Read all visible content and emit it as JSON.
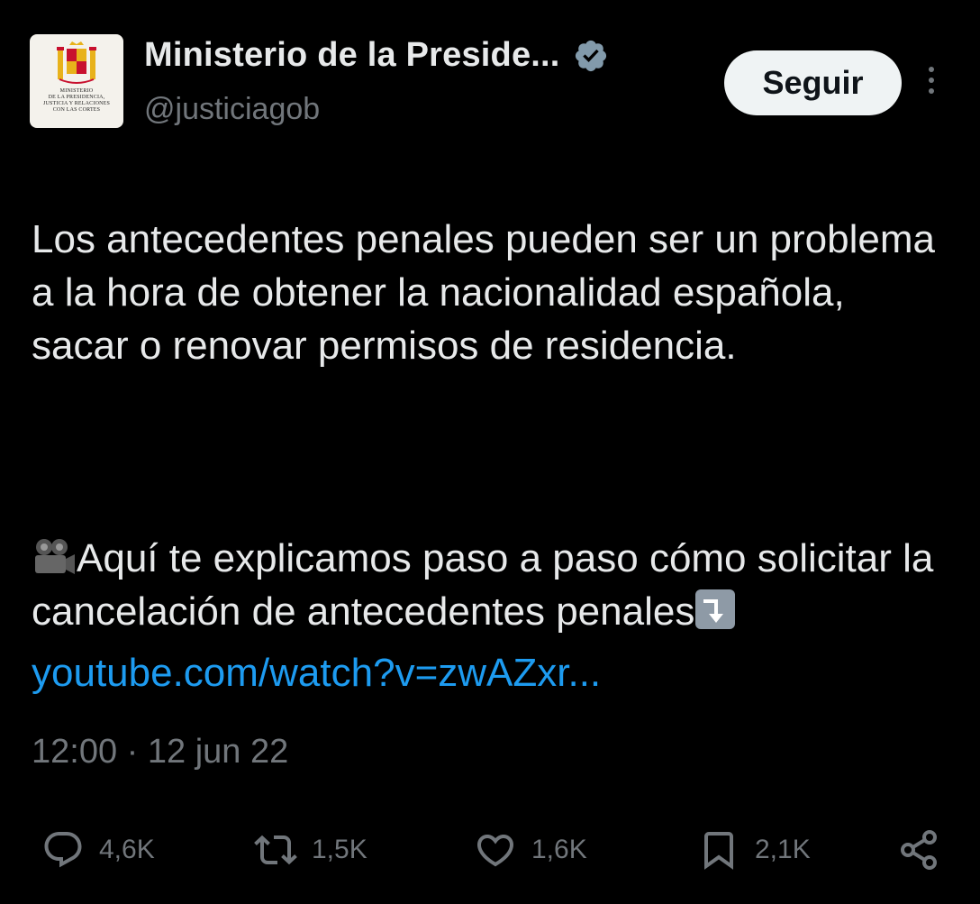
{
  "account": {
    "avatar_text": "MINISTERIO\nDE LA PRESIDENCIA,\nJUSTICIA Y RELACIONES\nCON LAS CORTES",
    "name": "Ministerio de la Preside...",
    "handle": "@justiciagob",
    "verified_icon": "verified-badge-icon"
  },
  "header": {
    "follow_label": "Seguir"
  },
  "tweet": {
    "paragraph1": "Los antecedentes penales pueden ser un problema a la hora de obtener la nacionalidad española, sacar o renovar permisos de residencia.",
    "paragraph2_text": "Aquí te explicamos paso a paso cómo solicitar la cancelación de antecedentes penales",
    "paragraph2_emoji_start": "movie-camera-icon",
    "paragraph2_emoji_end": "arrow-down-icon",
    "link": "youtube.com/watch?v=zwAZxr..."
  },
  "meta": {
    "time": "12:00",
    "separator": "·",
    "date": "12 jun 22"
  },
  "actions": {
    "replies": "4,6K",
    "retweets": "1,5K",
    "likes": "1,6K",
    "bookmarks": "2,1K"
  },
  "colors": {
    "background": "#000000",
    "text": "#e7e9ea",
    "muted": "#71767b",
    "link": "#1d9bf0",
    "verified": "#829aab",
    "button_bg": "#eff3f4"
  }
}
